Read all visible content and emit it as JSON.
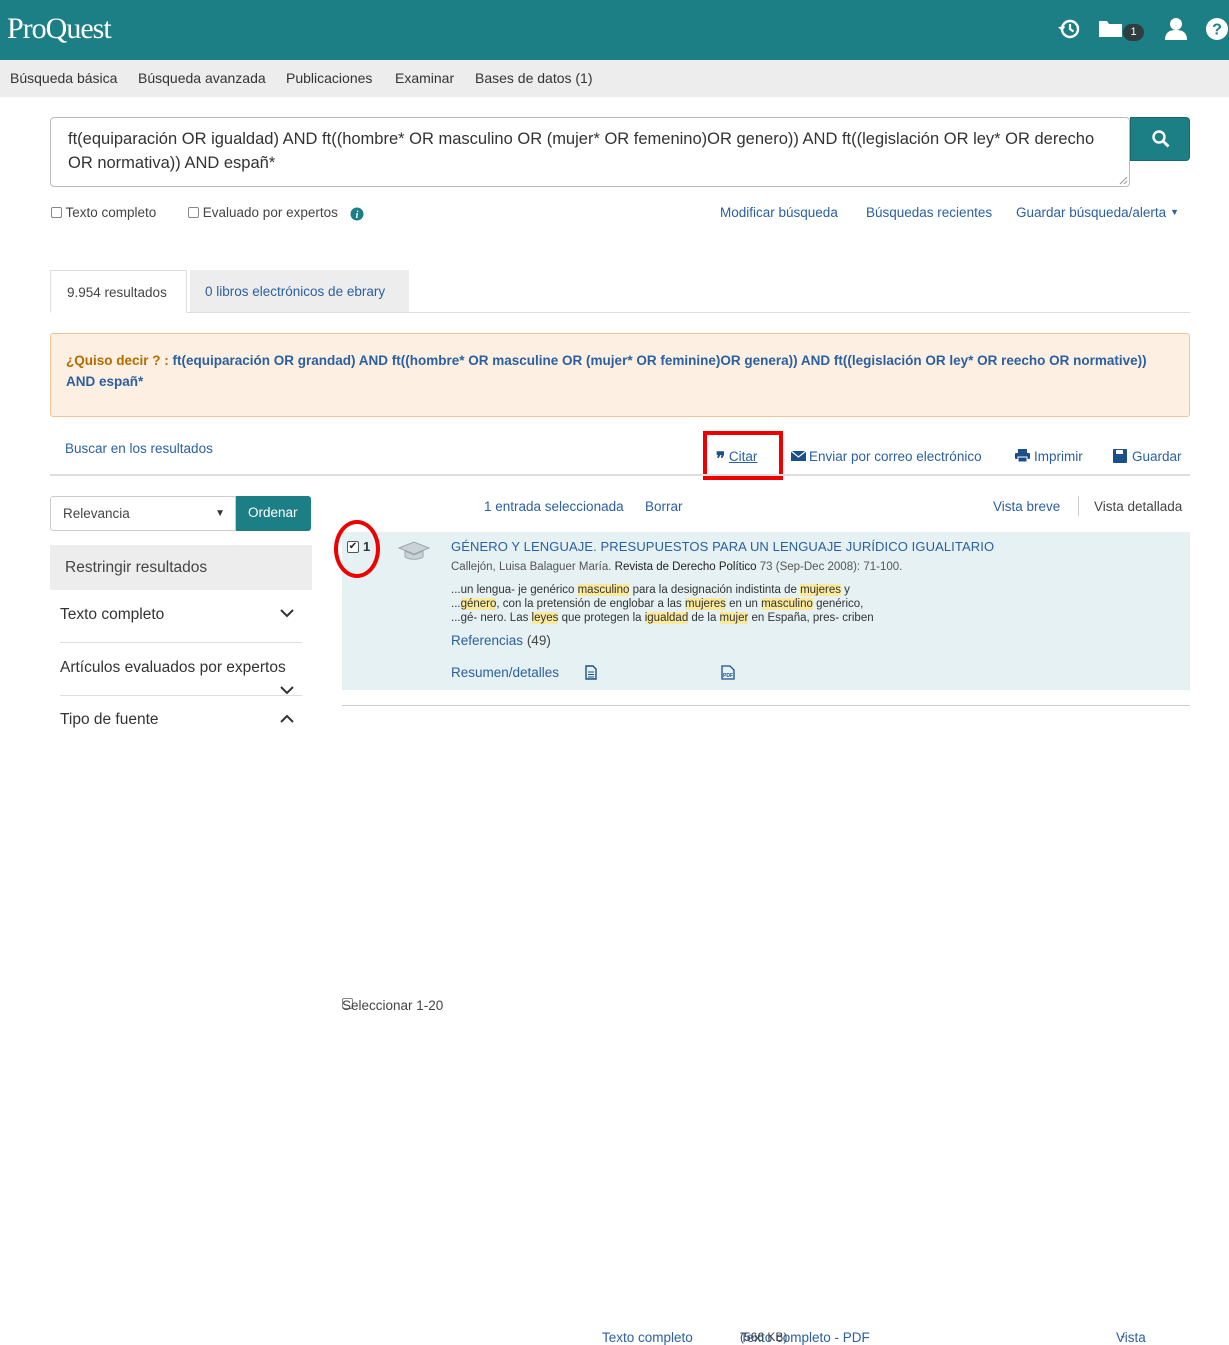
{
  "brand": {
    "logo": "ProQuest",
    "accent": "#1b7f85"
  },
  "header_icons": {
    "history": "history-icon",
    "folder": "folder-icon",
    "folder_count": "1",
    "user": "user-icon",
    "help": "help-icon"
  },
  "nav": [
    "Búsqueda básica",
    "Búsqueda avanzada",
    "Publicaciones",
    "Examinar",
    "Bases de datos (1)"
  ],
  "search": {
    "query": "ft(equiparación OR igualdad) AND ft((hombre* OR masculino OR (mujer* OR femenino)OR genero)) AND ft((legislación OR ley* OR derecho OR normativa)) AND españ*",
    "button_icon": "search-icon"
  },
  "options": {
    "full_text": "Texto completo",
    "peer_reviewed": "Evaluado por expertos"
  },
  "search_links": {
    "modify": "Modificar búsqueda",
    "recent": "Búsquedas recientes",
    "save_alert": "Guardar búsqueda/alerta"
  },
  "tabs": {
    "results": "9.954 resultados",
    "ebooks": "0 libros electrónicos de ebrary"
  },
  "did_you_mean": {
    "label": "¿Quiso decir ? :",
    "suggestion": "ft(equiparación OR grandad) AND ft((hombre* OR masculine OR (mujer* OR feminine)OR genera)) AND ft((legislación OR ley* OR reecho OR normative)) AND españ*"
  },
  "search_within": "Buscar en los resultados",
  "actions": {
    "cite": "Citar",
    "email": "Enviar por correo electrónico",
    "print": "Imprimir",
    "save": "Guardar"
  },
  "sort": {
    "selected": "Relevancia",
    "button": "Ordenar"
  },
  "sidebar": {
    "title": "Restringir resultados",
    "facets": [
      "Texto completo",
      "Artículos evaluados por expertos",
      "Tipo de fuente"
    ]
  },
  "results_bar": {
    "select_all": "Seleccionar 1-20",
    "selected_count": "1 entrada seleccionada",
    "clear": "Borrar",
    "brief": "Vista breve",
    "detailed": "Vista detallada"
  },
  "result": {
    "number": "1",
    "title": "GÉNERO Y LENGUAJE. PRESUPUESTOS PARA UN LENGUAJE JURÍDICO IGUALITARIO",
    "author": "Callejón, Luisa Balaguer María.",
    "journal": "Revista de Derecho Político",
    "citation": "73  (Sep-Dec 2008): 71-100.",
    "snippet": [
      [
        "...un lengua- je genérico ",
        "masculino",
        " para la designación indistinta de ",
        "mujeres",
        " y"
      ],
      [
        "...",
        "género",
        ", con la pretensión de englobar a las ",
        "mujeres",
        " en un ",
        "masculino",
        " genérico,"
      ],
      [
        "...gé- nero. Las ",
        "leyes",
        " que protegen la ",
        "igualdad",
        " de la ",
        "mujer",
        " en España, pres- criben"
      ]
    ],
    "references": "Referencias",
    "references_count": "(49)",
    "links": {
      "abstract": "Resumen/detalles",
      "full_text": "Texto completo",
      "pdf": "Texto completo - PDF",
      "pdf_size": "(566 KB)",
      "view": "Vista"
    }
  }
}
